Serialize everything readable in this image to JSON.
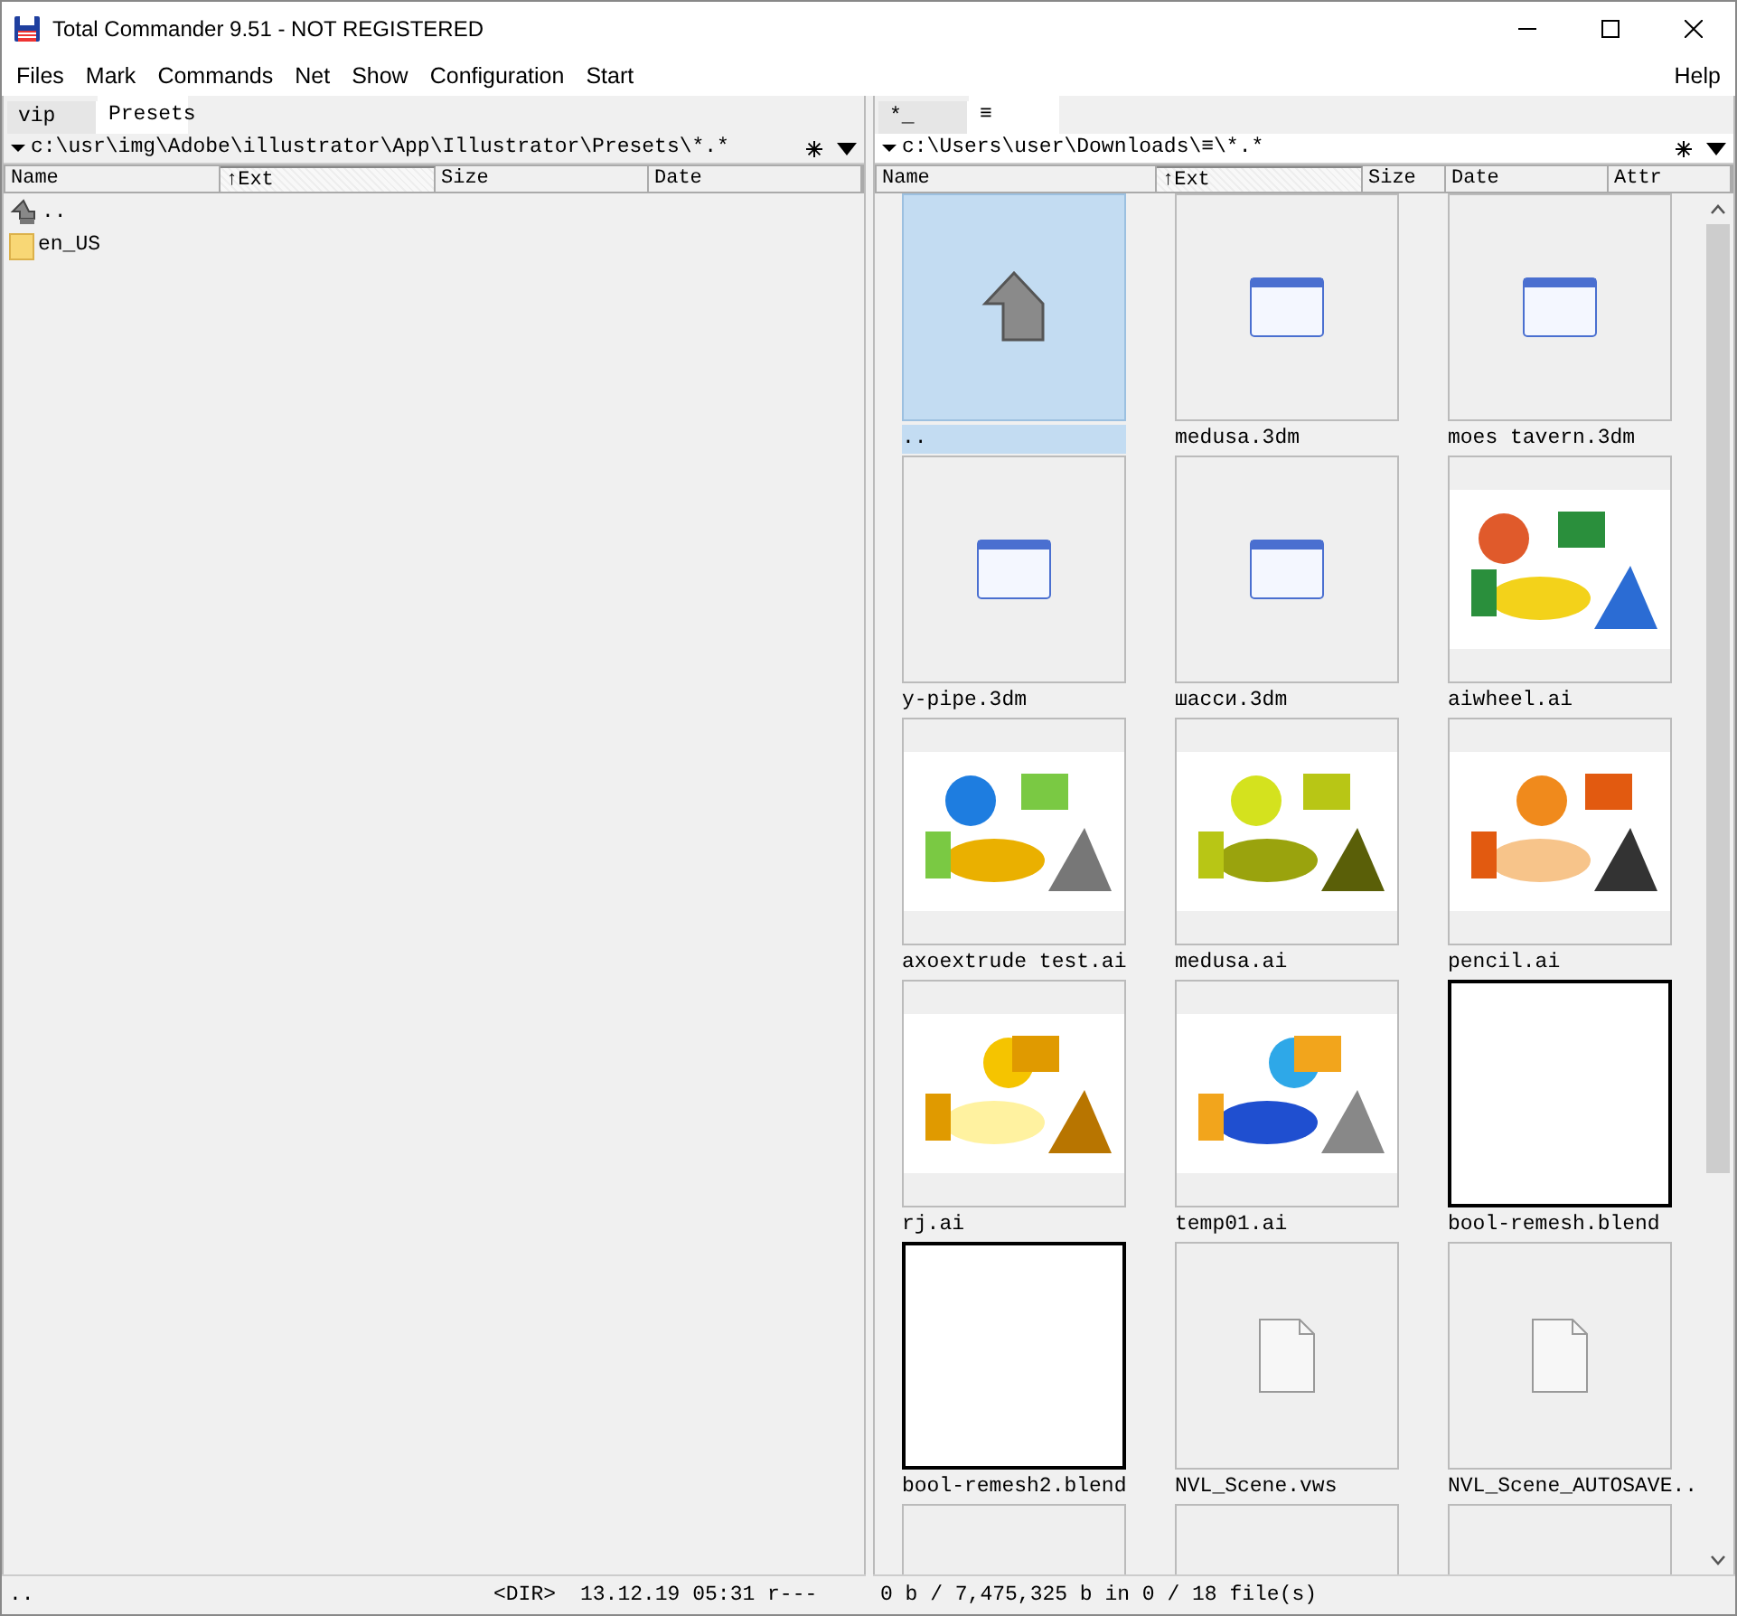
{
  "window": {
    "title": "Total Commander 9.51 - NOT REGISTERED"
  },
  "menu": [
    "Files",
    "Mark",
    "Commands",
    "Net",
    "Show",
    "Configuration",
    "Start"
  ],
  "help_menu": "Help",
  "left_panel": {
    "active": false,
    "tabs": [
      {
        "label": "vip",
        "selected": false
      },
      {
        "label": "Presets",
        "selected": true
      }
    ],
    "path": "c:\\usr\\img\\Adobe\\illustrator\\App\\Illustrator\\Presets\\*.*",
    "columns": [
      {
        "label": "Name",
        "sorted": false
      },
      {
        "label": "↑Ext",
        "sorted": true
      },
      {
        "label": "Size",
        "sorted": false
      },
      {
        "label": "Date",
        "sorted": false
      }
    ],
    "files": [
      {
        "kind": "updir",
        "name": ".."
      },
      {
        "kind": "folder",
        "name": "en_US"
      }
    ]
  },
  "right_panel": {
    "active": true,
    "tabs": [
      {
        "label": "*_",
        "selected": false
      },
      {
        "label": "≡",
        "selected": true
      }
    ],
    "path": "c:\\Users\\user\\Downloads\\≡\\*.*",
    "columns": [
      {
        "label": "Name",
        "sorted": false
      },
      {
        "label": "↑Ext",
        "sorted": true
      },
      {
        "label": "Size",
        "sorted": false
      },
      {
        "label": "Date",
        "sorted": false
      },
      {
        "label": "Attr",
        "sorted": false
      }
    ],
    "thumbnails": [
      {
        "kind": "updir",
        "name": "..",
        "selected": true
      },
      {
        "kind": "window",
        "name": "medusa.3dm",
        "selected": false
      },
      {
        "kind": "window",
        "name": "moes tavern.3dm",
        "selected": false
      },
      {
        "kind": "window",
        "name": "y-pipe.3dm",
        "selected": false
      },
      {
        "kind": "window",
        "name": "шасси.3dm",
        "selected": false
      },
      {
        "kind": "picture",
        "name": "aiwheel.ai",
        "selected": false
      },
      {
        "kind": "picture",
        "name": "axoextrude test.ai",
        "selected": false
      },
      {
        "kind": "picture",
        "name": "medusa.ai",
        "selected": false
      },
      {
        "kind": "picture",
        "name": "pencil.ai",
        "selected": false
      },
      {
        "kind": "picture",
        "name": "rj.ai",
        "selected": false
      },
      {
        "kind": "picture",
        "name": "temp01.ai",
        "selected": false
      },
      {
        "kind": "blank",
        "name": "bool-remesh.blend",
        "selected": false
      },
      {
        "kind": "blank",
        "name": "bool-remesh2.blend",
        "selected": false
      },
      {
        "kind": "file",
        "name": "NVL_Scene.vws",
        "selected": false
      },
      {
        "kind": "file",
        "name": "NVL_Scene_AUTOSAVE..",
        "selected": false
      },
      {
        "kind": "empty",
        "selected": false
      },
      {
        "kind": "empty",
        "selected": false
      },
      {
        "kind": "empty",
        "selected": false
      }
    ]
  },
  "status_left": {
    "name": "..",
    "size": "<DIR>",
    "details": "13.12.19 05:31 r---"
  },
  "status_right": "0 b / 7,475,325 b in 0 / 18 file(s)"
}
